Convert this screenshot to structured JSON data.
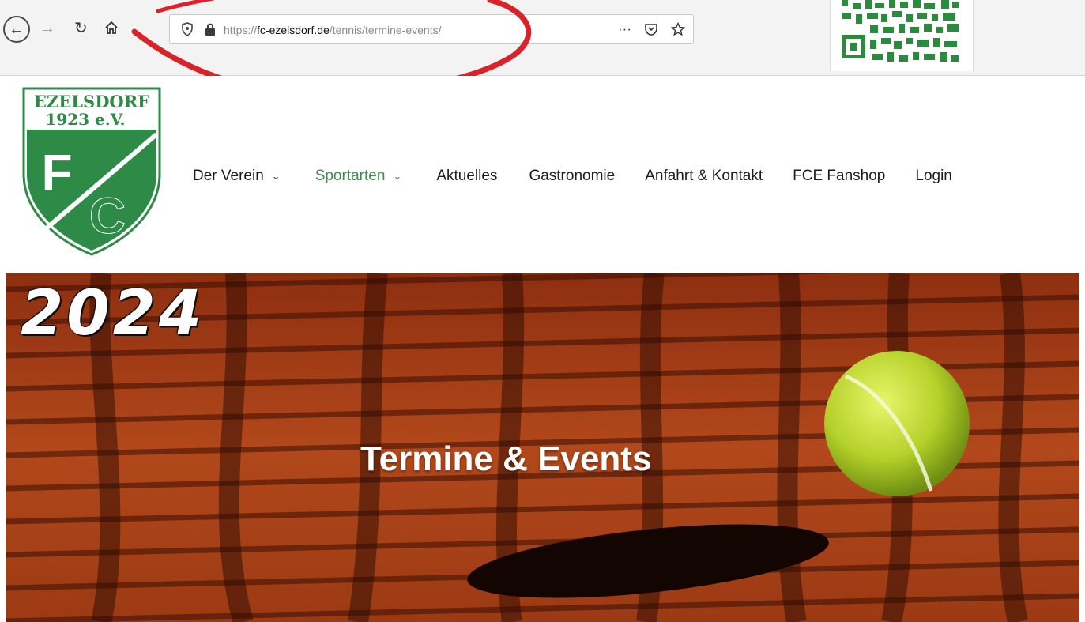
{
  "browser": {
    "url_prefix": "https://",
    "url_domain": "fc-ezelsdorf.de",
    "url_path": "/tennis/termine-events/",
    "more_label": "···"
  },
  "site": {
    "logo": {
      "line1": "EZELSDORF",
      "line2": "1923 e.V.",
      "letter1": "F",
      "letter2": "C",
      "colors": {
        "green": "#2e8b47",
        "white": "#ffffff"
      }
    },
    "nav": [
      {
        "label": "Der Verein",
        "has_dropdown": true,
        "active": false
      },
      {
        "label": "Sportarten",
        "has_dropdown": true,
        "active": true
      },
      {
        "label": "Aktuelles",
        "has_dropdown": false,
        "active": false
      },
      {
        "label": "Gastronomie",
        "has_dropdown": false,
        "active": false
      },
      {
        "label": "Anfahrt & Kontakt",
        "has_dropdown": false,
        "active": false
      },
      {
        "label": "FCE Fanshop",
        "has_dropdown": false,
        "active": false
      },
      {
        "label": "Login",
        "has_dropdown": false,
        "active": false
      }
    ],
    "accent_color": "#3e8a50"
  },
  "hero": {
    "title": "Termine & Events",
    "year_overlay": "2024",
    "court_color": "#a63d15"
  },
  "annotation": {
    "circle_color": "#d8232a"
  }
}
